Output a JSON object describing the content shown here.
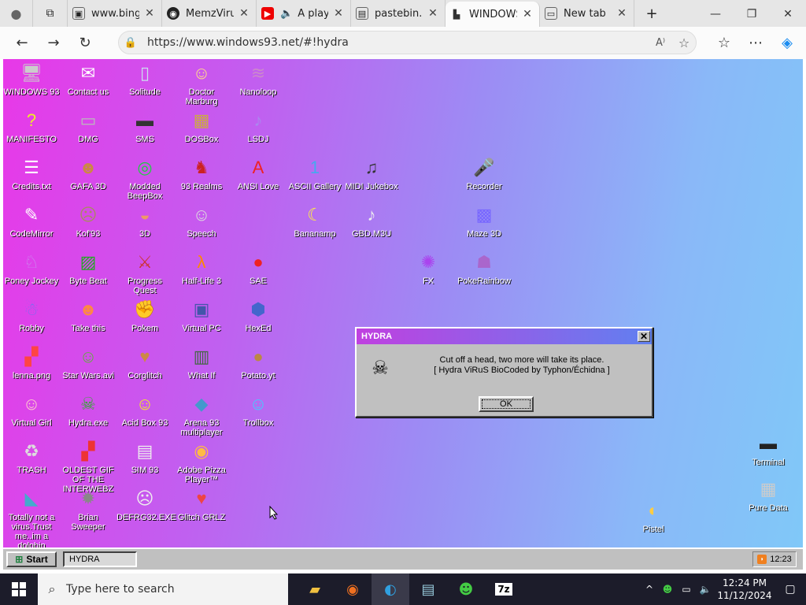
{
  "browser": {
    "tabs": [
      {
        "label": "www.bing.c",
        "icon": "bing-tab-icon"
      },
      {
        "label": "MemzVirus",
        "icon": "github-tab-icon"
      },
      {
        "label": "A play",
        "icon": "youtube-tab-icon"
      },
      {
        "label": "pastebin.co",
        "icon": "pastebin-tab-icon"
      },
      {
        "label": "WINDOWS",
        "icon": "windows93-tab-icon"
      },
      {
        "label": "New tab",
        "icon": "newtab-tab-icon"
      }
    ],
    "url": "https://www.windows93.net/#!hydra"
  },
  "desktop": {
    "icons": [
      {
        "label": "WINDOWS 93",
        "glyph": "🖥"
      },
      {
        "label": "Contact us",
        "glyph": "✉"
      },
      {
        "label": "Solitude",
        "glyph": "▯"
      },
      {
        "label": "Doctor Marburg",
        "glyph": "☺"
      },
      {
        "label": "Nanoloop",
        "glyph": "≋"
      },
      {
        "label": "MANIFESTO",
        "glyph": "?"
      },
      {
        "label": "DMG",
        "glyph": "▭"
      },
      {
        "label": "SMS",
        "glyph": "▬"
      },
      {
        "label": "DOSBox",
        "glyph": "▦"
      },
      {
        "label": "LSDJ",
        "glyph": "♪"
      },
      {
        "label": "Credits.txt",
        "glyph": "☰"
      },
      {
        "label": "GAFA 3D",
        "glyph": "☻"
      },
      {
        "label": "Modded BeepBox",
        "glyph": "◎"
      },
      {
        "label": "93 Realms",
        "glyph": "♞"
      },
      {
        "label": "ANSI Love",
        "glyph": "A"
      },
      {
        "label": "ASCII Gallery",
        "glyph": "1"
      },
      {
        "label": "MIDI Jukebox",
        "glyph": "♫"
      },
      {
        "label": "Recorder",
        "glyph": "🎤"
      },
      {
        "label": "CodeMirror",
        "glyph": "✎"
      },
      {
        "label": "Kof'93",
        "glyph": "☹"
      },
      {
        "label": "3D",
        "glyph": "◒"
      },
      {
        "label": "Speech",
        "glyph": "☺"
      },
      {
        "label": "Bananamp",
        "glyph": "☾"
      },
      {
        "label": "GBD.M3U",
        "glyph": "♪"
      },
      {
        "label": "Maze 3D",
        "glyph": "▩"
      },
      {
        "label": "Poney Jockey",
        "glyph": "♘"
      },
      {
        "label": "Byte Beat",
        "glyph": "▨"
      },
      {
        "label": "Progress Quest",
        "glyph": "⚔"
      },
      {
        "label": "Half-Life 3",
        "glyph": "λ"
      },
      {
        "label": "SAE",
        "glyph": "●"
      },
      {
        "label": "FX",
        "glyph": "✺"
      },
      {
        "label": "PokeRainbow",
        "glyph": "☗"
      },
      {
        "label": "Robby",
        "glyph": "☃"
      },
      {
        "label": "Take this",
        "glyph": "☻"
      },
      {
        "label": "Pokem",
        "glyph": "✊"
      },
      {
        "label": "Virtual PC",
        "glyph": "▣"
      },
      {
        "label": "HexEd",
        "glyph": "⬢"
      },
      {
        "label": "lenna.png",
        "glyph": "▞"
      },
      {
        "label": "Star Wars.avi",
        "glyph": "☺"
      },
      {
        "label": "Corglitch",
        "glyph": "♥"
      },
      {
        "label": "What If",
        "glyph": "▥"
      },
      {
        "label": "Potato.yt",
        "glyph": "●"
      },
      {
        "label": "Virtual Girl",
        "glyph": "☺"
      },
      {
        "label": "Hydra.exe",
        "glyph": "☠"
      },
      {
        "label": "Acid Box 93",
        "glyph": "☺"
      },
      {
        "label": "Arena 93 multiplayer",
        "glyph": "◆"
      },
      {
        "label": "Trollbox",
        "glyph": "☺"
      },
      {
        "label": "TRASH",
        "glyph": "♻"
      },
      {
        "label": "OLDEST GIF OF THE INTERWEBZ",
        "glyph": "▞"
      },
      {
        "label": "SIM 93",
        "glyph": "▤"
      },
      {
        "label": "Adobe Pizza Player™",
        "glyph": "◉"
      },
      {
        "label": "Totally not a virus.Trust me..im a dolphin",
        "glyph": "◣"
      },
      {
        "label": "Brian Sweeper",
        "glyph": "✹"
      },
      {
        "label": "DEFRG32.EXE",
        "glyph": "☹"
      },
      {
        "label": "Glitch GRLZ",
        "glyph": "♥"
      },
      {
        "label": "Pistel",
        "glyph": "◐"
      },
      {
        "label": "Terminal",
        "glyph": "▬"
      },
      {
        "label": "Pure Data",
        "glyph": "▦"
      }
    ]
  },
  "dialog": {
    "title": "HYDRA",
    "close": "✕",
    "line1": "Cut off a head, two more will take its place.",
    "line2": "[ Hydra ViRuS BioCoded by Typhon/Échidna ]",
    "ok": "OK"
  },
  "w93taskbar": {
    "start": "Start",
    "task": "HYDRA",
    "time": "12:23"
  },
  "wintaskbar": {
    "search_placeholder": "Type here to search",
    "time": "12:24 PM",
    "date": "11/12/2024"
  },
  "colors": {
    "accent": "#0078d4",
    "dialog_title_start": "#c040e0",
    "dialog_title_end": "#6080f0"
  }
}
